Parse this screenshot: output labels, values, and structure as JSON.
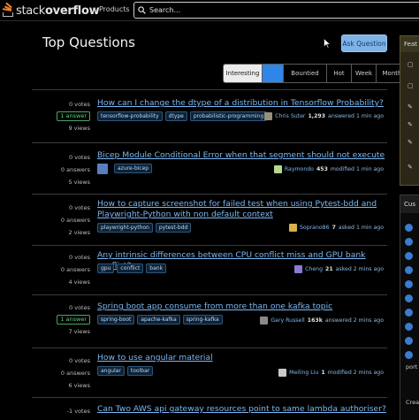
{
  "header": {
    "logo_text_light": "stack",
    "logo_text_bold": "overflow",
    "products_label": "Products",
    "search_placeholder": "Search..."
  },
  "page": {
    "title": "Top Questions",
    "ask_button": "Ask Question"
  },
  "tabs": [
    {
      "label": "Interesting",
      "state": "active"
    },
    {
      "label": "Hot",
      "state": "highlighted"
    },
    {
      "label": "Bountied",
      "state": "normal"
    },
    {
      "label": "Hot",
      "state": "normal"
    },
    {
      "label": "Week",
      "state": "normal"
    },
    {
      "label": "Month",
      "state": "normal"
    }
  ],
  "questions": [
    {
      "votes": "0 votes",
      "answers": "1 answer",
      "answered": true,
      "views": "9 views",
      "title": "How can I change the dtype of a distribution in Tensorflow Probability?",
      "tags": [
        "tensorflow-probability",
        "dtype",
        "probabilistic-programming"
      ],
      "user": "Chris Suter",
      "rep": "1,293",
      "activity": "answered 1 min ago",
      "avatar_color": "#9a8f7a"
    },
    {
      "votes": "0 votes",
      "answers": "0 answers",
      "answered": false,
      "views": "5 views",
      "title": "Bicep Module Conditional Error when that segment should not execute",
      "tags": [
        "azure-bicep"
      ],
      "user": "Raymondo",
      "rep": "453",
      "activity": "modified 1 min ago",
      "avatar_color": "#b9d98a"
    },
    {
      "votes": "0 votes",
      "answers": "0 answers",
      "answered": false,
      "views": "2 views",
      "title": "How to capture screenshot for failed test when using Pytest-bdd and Playwright-Python with non default context",
      "tags": [
        "playwright-python",
        "pytest-bdd"
      ],
      "user": "Soprano86",
      "rep": "7",
      "activity": "asked 1 min ago",
      "avatar_color": "#d8b24a"
    },
    {
      "votes": "0 votes",
      "answers": "0 answers",
      "answered": false,
      "views": "4 views",
      "title": "Any intrinsic differences between CPU conflict miss and GPU bank conflict?",
      "tags": [
        "gpu",
        "conflict",
        "bank"
      ],
      "user": "Cheng",
      "rep": "21",
      "activity": "asked 2 mins ago",
      "avatar_color": "#8a7ad8"
    },
    {
      "votes": "0 votes",
      "answers": "1 answer",
      "answered": true,
      "views": "7 views",
      "title": "Spring boot app consume from more than one kafka topic",
      "tags": [
        "spring-boot",
        "apache-kafka",
        "spring-kafka"
      ],
      "user": "Gary Russell",
      "rep": "163k",
      "activity": "answered 2 mins ago",
      "avatar_color": "#8a8a8a"
    },
    {
      "votes": "0 votes",
      "answers": "0 answers",
      "answered": false,
      "views": "6 views",
      "title": "How to use angular material",
      "tags": [
        "angular",
        "toolbar"
      ],
      "user": "Meiling Liu",
      "rep": "1",
      "activity": "modified 2 mins ago",
      "avatar_color": "#c9c9c9"
    },
    {
      "votes": "-1 votes",
      "answers": "",
      "answered": false,
      "views": "",
      "title": "Can Two AWS api gateway resources point to same lambda authoriser?",
      "tags": [],
      "user": "",
      "rep": "",
      "activity": "",
      "avatar_color": "#888888"
    }
  ],
  "sidebar": {
    "featured_header": "Feat",
    "custom_header": "Cus",
    "custom_tail_1": "port",
    "custom_tail_2": "Crea"
  },
  "colors": {
    "link": "#7cb8f2",
    "accent": "#f48024",
    "answered": "#5fcf7e",
    "ask_button_bg": "#7fb2e6"
  }
}
